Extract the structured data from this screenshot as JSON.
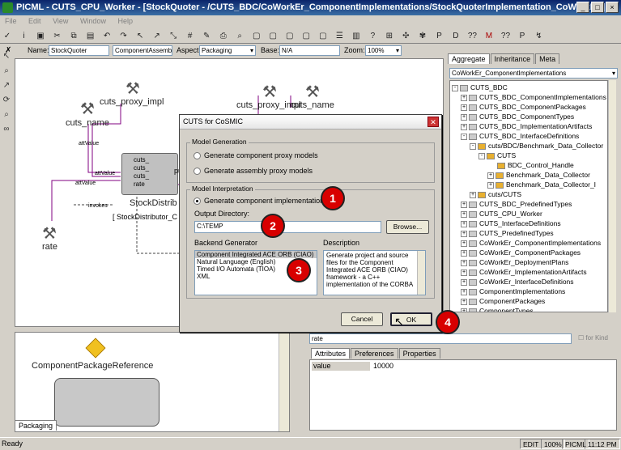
{
  "window": {
    "title": "PICML - CUTS_CPU_Worker - [StockQuoter - /CUTS_BDC/CoWorkEr_ComponentImplementations/StockQuoterImplementation_CoWorkEr/]"
  },
  "menu": [
    "File",
    "Edit",
    "View",
    "Window",
    "Help"
  ],
  "propbar": {
    "name_label": "Name:",
    "name_value": "StockQuoter",
    "kind_value": "ComponentAssembl",
    "aspect_label": "Aspect:",
    "aspect_value": "Packaging",
    "base_label": "Base:",
    "base_value": "N/A",
    "zoom_label": "Zoom:",
    "zoom_value": "100%"
  },
  "canvas": {
    "labels": {
      "proxy1": "cuts_proxy_impl",
      "name1": "cuts_name",
      "proxy2": "cuts_proxy_impl",
      "name2": "cuts_name",
      "rate": "rate",
      "stock": "StockDistrib",
      "stock_sub": "[ StockDistributor_C",
      "pub": "pu",
      "port1": "cuts_",
      "port2": "cuts_",
      "port3": "cuts_",
      "port4": "rate",
      "att1": "attValue",
      "att2": "attValue",
      "att3": "attValue",
      "invokes": "invokes"
    }
  },
  "right_panel": {
    "tabs": [
      "Aggregate",
      "Inheritance",
      "Meta"
    ],
    "selector": "CoWorkEr_ComponentImplementations",
    "tree": [
      {
        "label": "CUTS_BDC",
        "indent": 0,
        "exp": "-"
      },
      {
        "label": "CUTS_BDC_ComponentImplementations",
        "indent": 1,
        "exp": "+"
      },
      {
        "label": "CUTS_BDC_ComponentPackages",
        "indent": 1,
        "exp": "+"
      },
      {
        "label": "CUTS_BDC_ComponentTypes",
        "indent": 1,
        "exp": "+"
      },
      {
        "label": "CUTS_BDC_ImplementationArtifacts",
        "indent": 1,
        "exp": "+"
      },
      {
        "label": "CUTS_BDC_InterfaceDefinitions",
        "indent": 1,
        "exp": "-"
      },
      {
        "label": "cuts/BDC/Benchmark_Data_Collector",
        "indent": 2,
        "exp": "-"
      },
      {
        "label": "CUTS",
        "indent": 3,
        "exp": "-"
      },
      {
        "label": "BDC_Control_Handle",
        "indent": 4,
        "exp": ""
      },
      {
        "label": "Benchmark_Data_Collector",
        "indent": 4,
        "exp": "+"
      },
      {
        "label": "Benchmark_Data_Collector_I",
        "indent": 4,
        "exp": "+"
      },
      {
        "label": "cuts/CUTS",
        "indent": 2,
        "exp": "+"
      },
      {
        "label": "CUTS_BDC_PredefinedTypes",
        "indent": 1,
        "exp": "+"
      },
      {
        "label": "CUTS_CPU_Worker",
        "indent": 1,
        "exp": "+"
      },
      {
        "label": "CUTS_InterfaceDefinitions",
        "indent": 1,
        "exp": "+"
      },
      {
        "label": "CUTS_PredefinedTypes",
        "indent": 1,
        "exp": "+"
      },
      {
        "label": "CoWorkEr_ComponentImplementations",
        "indent": 1,
        "exp": "+"
      },
      {
        "label": "CoWorkEr_ComponentPackages",
        "indent": 1,
        "exp": "+"
      },
      {
        "label": "CoWorkEr_DeploymentPlans",
        "indent": 1,
        "exp": "+"
      },
      {
        "label": "CoWorkEr_ImplementationArtifacts",
        "indent": 1,
        "exp": "+"
      },
      {
        "label": "CoWorkEr_InterfaceDefinitions",
        "indent": 1,
        "exp": "+"
      },
      {
        "label": "ComponentImplementations",
        "indent": 1,
        "exp": "+"
      },
      {
        "label": "ComponentPackages",
        "indent": 1,
        "exp": "+"
      },
      {
        "label": "ComponentTypes",
        "indent": 1,
        "exp": "+"
      }
    ]
  },
  "bottom_left": {
    "label": "ComponentPackageReference",
    "tab": "Packaging"
  },
  "bottom_right": {
    "name_value": "rate",
    "forkind": "for Kind",
    "tabs": [
      "Attributes",
      "Preferences",
      "Properties"
    ],
    "attr_name": "value",
    "attr_value": "10000"
  },
  "dialog": {
    "title": "CUTS for CoSMIC",
    "model_generation": "Model Generation",
    "opt_proxy": "Generate component proxy models",
    "opt_assembly": "Generate assembly proxy models",
    "model_interpretation": "Model Interpretation",
    "opt_impl": "Generate component implementation",
    "output_label": "Output Directory:",
    "output_value": "C:\\TEMP",
    "browse": "Browse...",
    "backend_label": "Backend Generator",
    "backends": [
      "Component Integrated ACE ORB (CIAO)",
      "Natural Language (English)",
      "Timed I/O Automata (TIOA)",
      "XML"
    ],
    "description_label": "Description",
    "description": "Generate project and source files for the Component Integrated ACE ORB (CIAO) framework - a C++ implementation of the CORBA",
    "cancel": "Cancel",
    "ok": "OK"
  },
  "badges": [
    "1",
    "2",
    "3",
    "4"
  ],
  "status": {
    "left": "Ready",
    "mode": "EDIT",
    "zoom": "100%",
    "app": "PICML",
    "time": "11:12 PM"
  }
}
